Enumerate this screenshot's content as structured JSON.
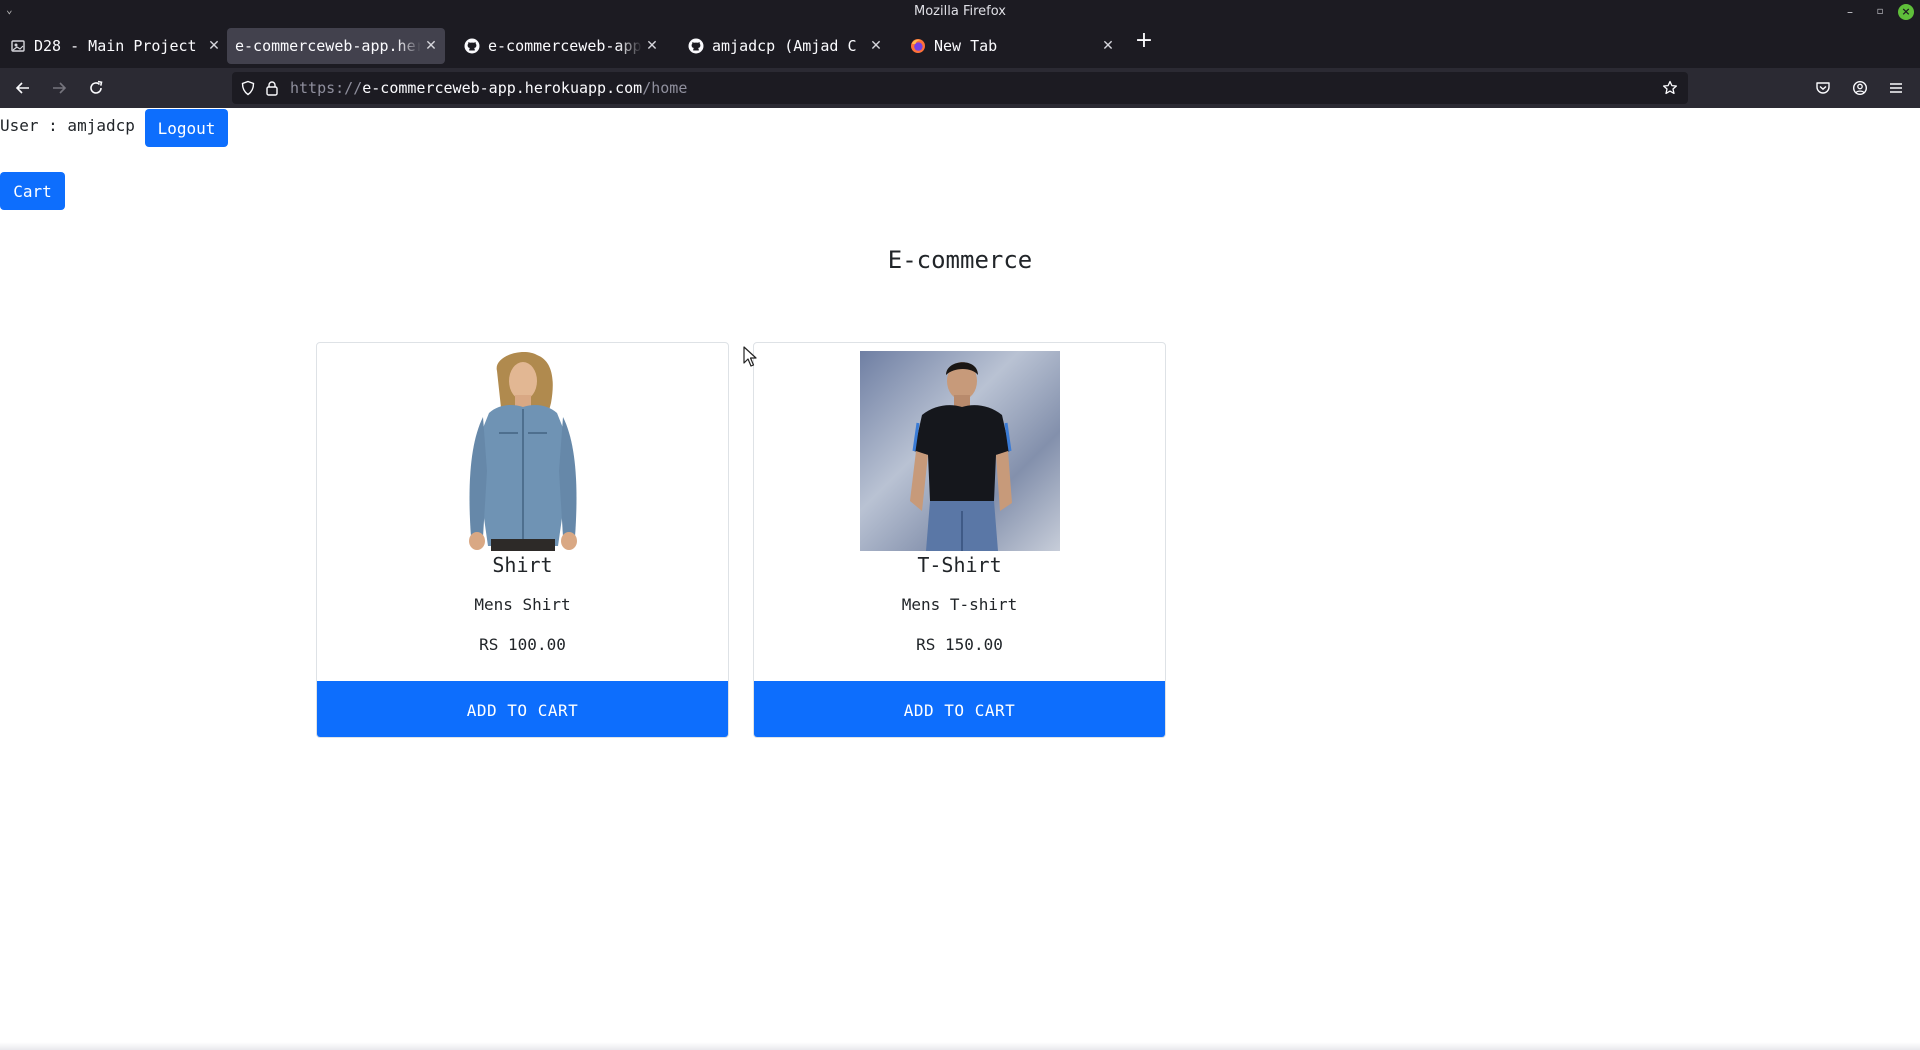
{
  "window": {
    "title": "Mozilla Firefox"
  },
  "tabs": [
    {
      "label": "D28 - Main Project",
      "icon": "document-icon",
      "active": false
    },
    {
      "label": "e-commerceweb-app.herokuapp.com/home",
      "icon": "",
      "active": true
    },
    {
      "label": "e-commerceweb-app/README.md",
      "icon": "github-icon",
      "active": false
    },
    {
      "label": "amjadcp (Amjad C P)",
      "icon": "github-icon",
      "active": false
    },
    {
      "label": "New Tab",
      "icon": "firefox-icon",
      "active": false
    }
  ],
  "urlbar": {
    "scheme": "https://",
    "host": "e-commerceweb-app.herokuapp.com",
    "path": "/home"
  },
  "page": {
    "user_label": "User : amjadcp",
    "logout_label": "Logout",
    "cart_label": "Cart",
    "title": "E-commerce",
    "products": [
      {
        "name": "Shirt",
        "description": "Mens Shirt",
        "price": "RS 100.00",
        "button": "ADD TO CART"
      },
      {
        "name": "T-Shirt",
        "description": "Mens T-shirt",
        "price": "RS 150.00",
        "button": "ADD TO CART"
      }
    ]
  },
  "colors": {
    "primary": "#0d6efd",
    "chrome_dark": "#1c1b22",
    "toolbar": "#2b2a33",
    "active_tab": "#42414d"
  }
}
